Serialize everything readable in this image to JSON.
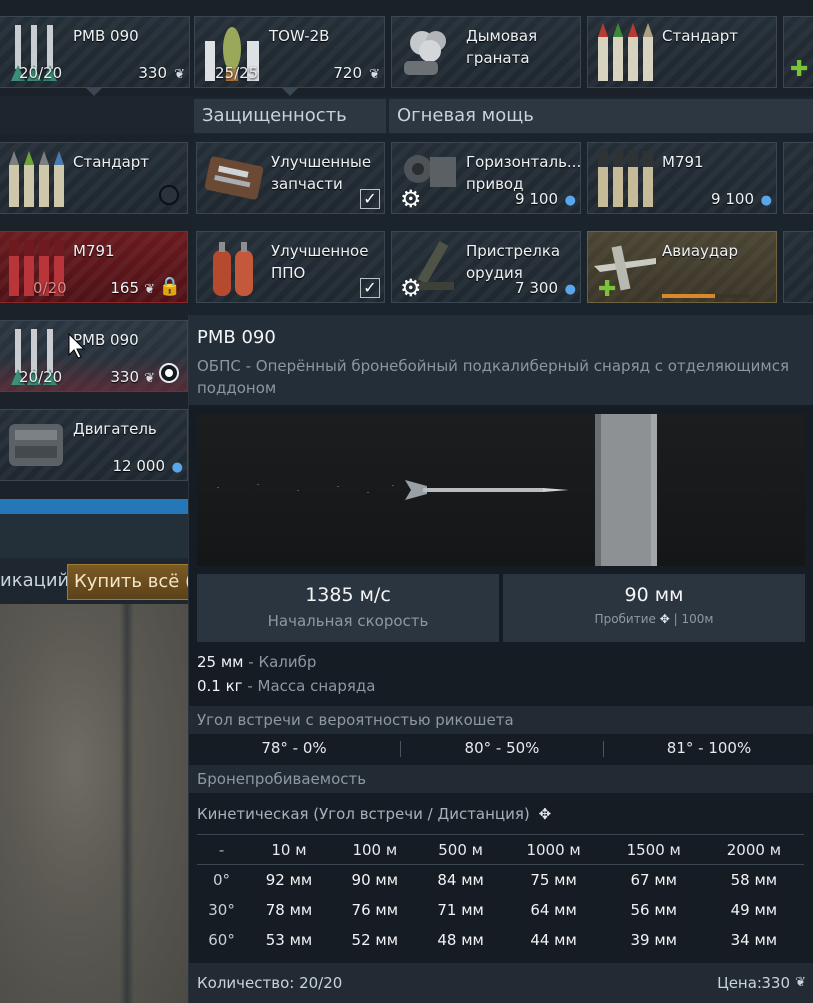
{
  "colors": {
    "accent_blue": "#2578b8",
    "lock_red": "#e0262e",
    "progress_orange": "#d9892c",
    "buy_button": "#6b4d1f"
  },
  "tiles": {
    "t1": {
      "name": "РМВ 090",
      "count": "20/20",
      "cost": "330",
      "cost_icon": "eagle-icon"
    },
    "t2": {
      "name": "TOW-2B",
      "count": "25/25",
      "cost": "720",
      "cost_icon": "eagle-icon"
    },
    "t3": {
      "name": "Дымовая граната"
    },
    "t4": {
      "name": "Стандарт"
    },
    "t5": {
      "name": "Стандарт"
    },
    "t6": {
      "name": "Улучшенные запчасти"
    },
    "t7": {
      "name": "Горизонталь... привод",
      "cost": "9 100",
      "cost_icon": "drop-icon"
    },
    "t8": {
      "name": "M791",
      "cost": "9 100",
      "cost_icon": "drop-icon"
    },
    "t9": {
      "name": "M791",
      "count": "0/20",
      "cost": "165",
      "cost_icon": "eagle-icon"
    },
    "t10": {
      "name": "Улучшенное ППО"
    },
    "t11": {
      "name": "Пристрелка орудия",
      "cost": "7 300",
      "cost_icon": "drop-icon"
    },
    "t12": {
      "name": "Авиаудар",
      "progress": 0.6
    },
    "t13": {
      "name": "РМВ 090",
      "count": "20/20",
      "cost": "330",
      "cost_icon": "eagle-icon"
    },
    "t14": {
      "name": "Двигатель",
      "cost": "12 000",
      "cost_icon": "drop-icon"
    }
  },
  "sections": {
    "protection": "Защищенность",
    "firepower": "Огневая мощь"
  },
  "bottom": {
    "partial_label": "икаций",
    "buy_all": "Купить всё ("
  },
  "tooltip": {
    "title": "РМВ 090",
    "subtitle": "ОБПС - Оперённый бронебойный подкалиберный снаряд с отделяющимся поддоном",
    "velocity_value": "1385 м/с",
    "velocity_label": "Начальная скорость",
    "pen_value": "90 мм",
    "pen_label": "Пробитие",
    "pen_range": "| 100м",
    "caliber_value": "25 мм",
    "caliber_label": "- Калибр",
    "mass_value": "0.1 кг",
    "mass_label": "- Масса снаряда",
    "ricochet_title": "Угол встречи с вероятностью рикошета",
    "ricochet": [
      "78° - 0%",
      "80° - 50%",
      "81° - 100%"
    ],
    "armor_title": "Бронепробиваемость",
    "kinetic_label": "Кинетическая (Угол встречи / Дистанция)",
    "table": {
      "headers": [
        "-",
        "10 м",
        "100 м",
        "500 м",
        "1000 м",
        "1500 м",
        "2000 м"
      ],
      "rows": [
        [
          "0°",
          "92 мм",
          "90 мм",
          "84 мм",
          "75 мм",
          "67 мм",
          "58 мм"
        ],
        [
          "30°",
          "78 мм",
          "76 мм",
          "71 мм",
          "64 мм",
          "56 мм",
          "49 мм"
        ],
        [
          "60°",
          "53 мм",
          "52 мм",
          "48 мм",
          "44 мм",
          "39 мм",
          "34 мм"
        ]
      ]
    },
    "quantity": "Количество: 20/20",
    "price_label": "Цена:",
    "price_value": "330"
  }
}
